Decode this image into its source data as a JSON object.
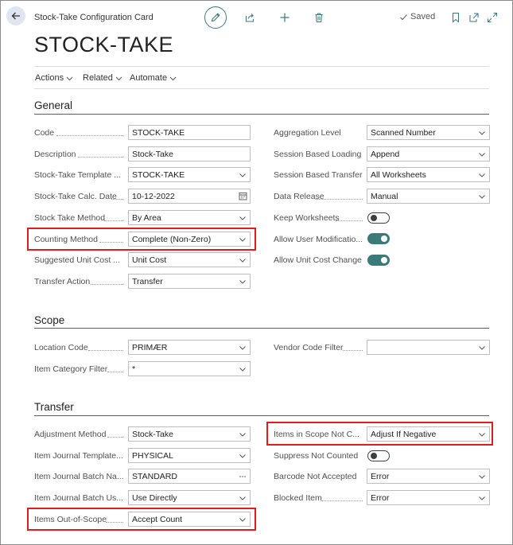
{
  "header": {
    "small_title": "Stock-Take Configuration Card",
    "saved_label": "Saved",
    "title": "STOCK-TAKE"
  },
  "menu": {
    "actions": "Actions",
    "related": "Related",
    "automate": "Automate"
  },
  "colors": {
    "accent": "#3a7a78",
    "highlight": "#e21c1c"
  },
  "general": {
    "title": "General",
    "code": {
      "label": "Code",
      "value": "STOCK-TAKE"
    },
    "description": {
      "label": "Description",
      "value": "Stock-Take"
    },
    "template": {
      "label": "Stock-Take Template ...",
      "value": "STOCK-TAKE"
    },
    "calc_date": {
      "label": "Stock-Take Calc. Date",
      "value": "10-12-2022"
    },
    "method": {
      "label": "Stock Take Method",
      "value": "By Area"
    },
    "counting": {
      "label": "Counting Method",
      "value": "Complete (Non-Zero)"
    },
    "unit_cost": {
      "label": "Suggested Unit Cost ...",
      "value": "Unit Cost"
    },
    "transfer_action": {
      "label": "Transfer Action",
      "value": "Transfer"
    },
    "aggregation": {
      "label": "Aggregation Level",
      "value": "Scanned Number"
    },
    "session_loading": {
      "label": "Session Based Loading",
      "value": "Append"
    },
    "session_transfer": {
      "label": "Session Based Transfer",
      "value": "All Worksheets"
    },
    "data_release": {
      "label": "Data Release",
      "value": "Manual"
    },
    "keep_worksheets": {
      "label": "Keep Worksheets",
      "on": false
    },
    "allow_user_mod": {
      "label": "Allow User Modificatio...",
      "on": true
    },
    "allow_unit_cost": {
      "label": "Allow Unit Cost Change",
      "on": true
    }
  },
  "scope": {
    "title": "Scope",
    "location": {
      "label": "Location Code",
      "value": "PRIMÆR"
    },
    "item_category": {
      "label": "Item Category Filter",
      "value": "*"
    },
    "vendor": {
      "label": "Vendor Code Filter",
      "value": ""
    }
  },
  "transfer": {
    "title": "Transfer",
    "adjustment": {
      "label": "Adjustment Method",
      "value": "Stock-Take"
    },
    "journal_template": {
      "label": "Item Journal Template...",
      "value": "PHYSICAL"
    },
    "journal_batch": {
      "label": "Item Journal Batch Na...",
      "value": "STANDARD"
    },
    "journal_batch_usage": {
      "label": "Item Journal Batch Us...",
      "value": "Use Directly"
    },
    "out_of_scope": {
      "label": "Items Out-of-Scope",
      "value": "Accept Count"
    },
    "not_counted": {
      "label": "Items in Scope Not C...",
      "value": "Adjust If Negative"
    },
    "suppress": {
      "label": "Suppress Not Counted",
      "on": false
    },
    "barcode": {
      "label": "Barcode Not Accepted",
      "value": "Error"
    },
    "blocked": {
      "label": "Blocked Item",
      "value": "Error"
    }
  }
}
